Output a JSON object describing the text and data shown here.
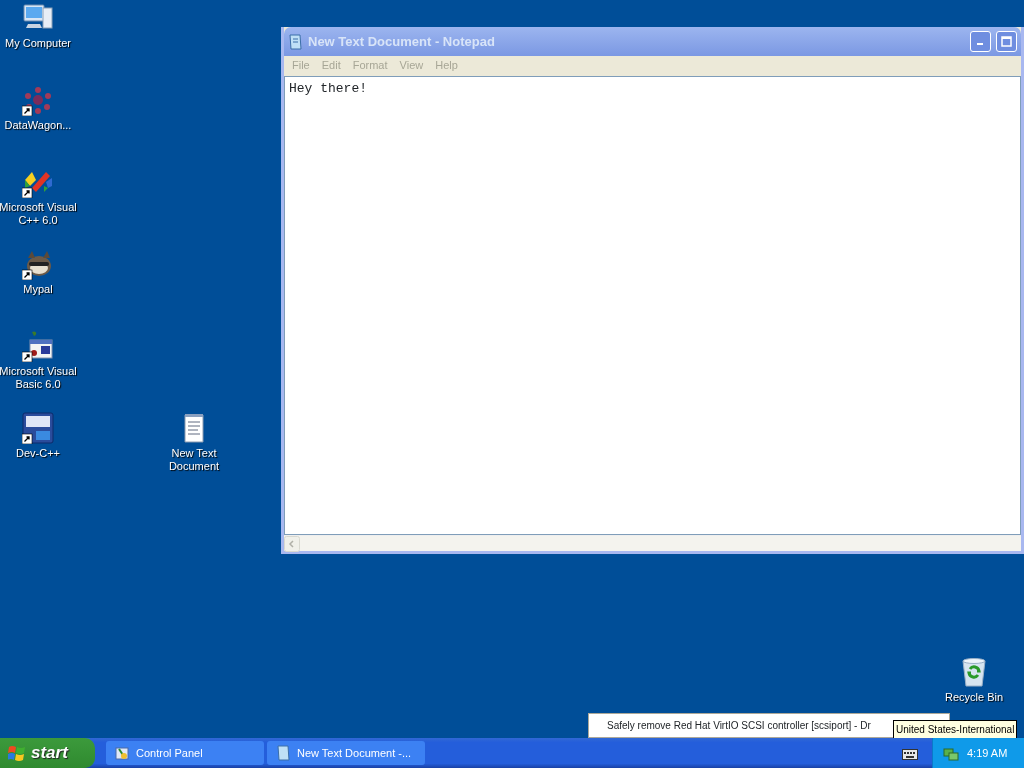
{
  "desktop_icons": [
    {
      "label": "My Computer",
      "kind": "computer",
      "shortcut": false
    },
    {
      "label": "DataWagon...",
      "kind": "network",
      "shortcut": true
    },
    {
      "label": "Microsoft Visual C++ 6.0",
      "kind": "vcpp",
      "shortcut": true
    },
    {
      "label": "Mypal",
      "kind": "mypal",
      "shortcut": true
    },
    {
      "label": "Microsoft Visual Basic 6.0",
      "kind": "vb",
      "shortcut": true
    },
    {
      "label": "Dev-C++",
      "kind": "devcpp",
      "shortcut": true
    },
    {
      "label": "New Text Document",
      "kind": "textfile",
      "shortcut": false
    },
    {
      "label": "Recycle Bin",
      "kind": "recyclebin",
      "shortcut": false
    }
  ],
  "notepad": {
    "title": "New Text Document - Notepad",
    "active": false,
    "menu": [
      "File",
      "Edit",
      "Format",
      "View",
      "Help"
    ],
    "content": "Hey there!"
  },
  "popup_menu": {
    "items": [
      "Safely remove Red Hat VirtIO SCSI controller [scsiport] - Dr"
    ]
  },
  "tooltip": "United States-International",
  "taskbar": {
    "start": "start",
    "tasks": [
      {
        "label": "Control Panel",
        "kind": "controlpanel",
        "selected": false
      },
      {
        "label": "New Text Document -...",
        "kind": "notepad",
        "selected": false
      }
    ],
    "clock": "4:19 AM"
  }
}
